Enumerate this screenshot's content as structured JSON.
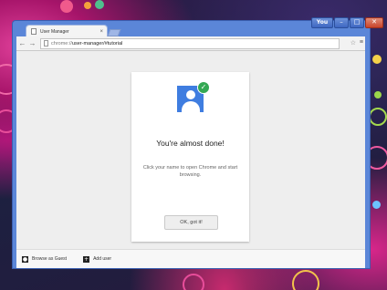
{
  "window": {
    "user_label": "You",
    "minimize": "–",
    "maximize": "□",
    "close": "✕"
  },
  "tab": {
    "title": "User Manager",
    "close": "×"
  },
  "toolbar": {
    "back": "←",
    "forward": "→",
    "url_scheme": "chrome://",
    "url_rest": "user-manager/#tutorial",
    "star": "☆",
    "menu": "≡"
  },
  "card": {
    "title": "You're almost done!",
    "description": "Click your name to open Chrome and start browsing.",
    "ok_label": "OK, got it!",
    "check_glyph": "✓",
    "accent": "#3f7de0",
    "check_color": "#34a853"
  },
  "footer": {
    "guest_label": "Browse as Guest",
    "guest_icon": "person-icon",
    "add_label": "Add user",
    "add_icon": "plus-icon"
  }
}
